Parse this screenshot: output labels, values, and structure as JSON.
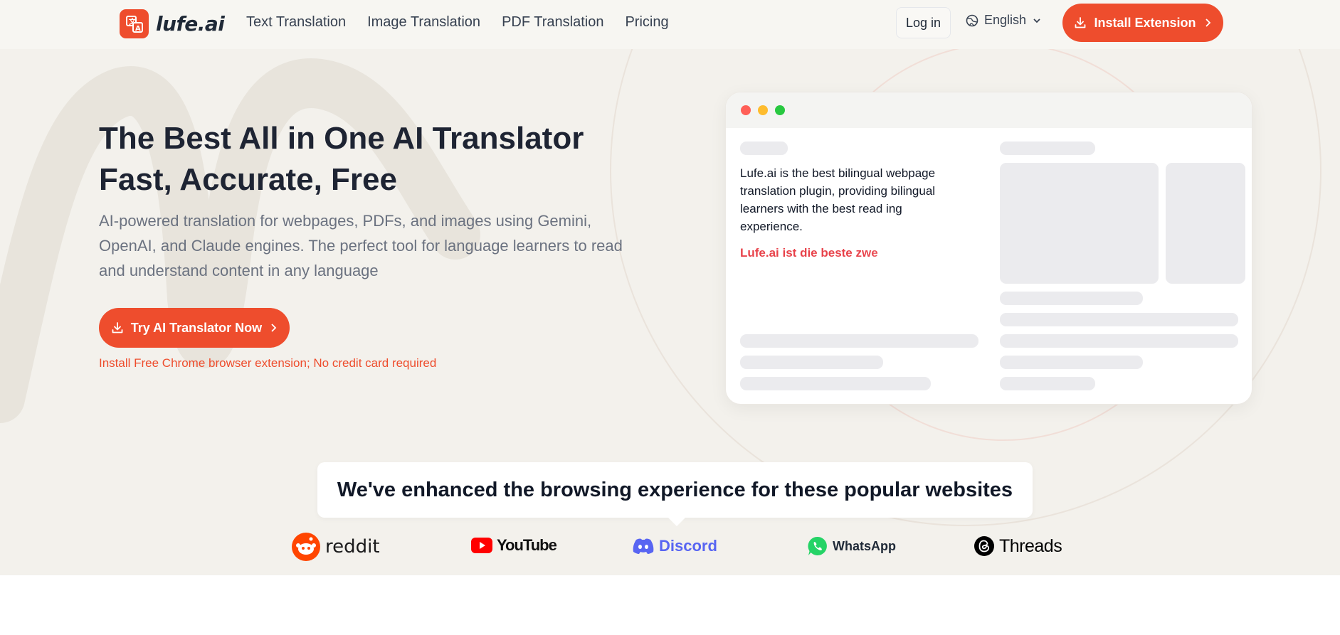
{
  "brand": {
    "name": "lufe.ai",
    "accent": "#ee4d2d"
  },
  "nav": {
    "links": [
      "Text Translation",
      "Image Translation",
      "PDF Translation",
      "Pricing"
    ],
    "login_label": "Log in",
    "language": "English",
    "install_label": "Install Extension"
  },
  "hero": {
    "title_line1": "The Best All in One AI Translator",
    "title_line2": "Fast, Accurate, Free",
    "subtitle": "AI-powered translation for webpages, PDFs, and images using Gemini, OpenAI, and Claude engines. The perfect tool for language learners to read and understand content in any language",
    "cta_label": "Try AI Translator Now",
    "cta_note": "Install Free Chrome browser extension; No credit card required"
  },
  "mockup": {
    "window_dots": [
      "#ff5f57",
      "#febc2e",
      "#28c840"
    ],
    "english_text": "Lufe.ai is the best bilingual webpage translation plugin, providing bilingual learners with the best read ing experience.",
    "german_text": "Lufe.ai ist die beste zwe"
  },
  "popular": {
    "heading": "We've enhanced the browsing experience for these popular websites",
    "sites": [
      {
        "name": "reddit",
        "icon": "reddit-icon",
        "color": "#ff4500"
      },
      {
        "name": "YouTube",
        "icon": "youtube-icon",
        "color": "#ff0000"
      },
      {
        "name": "Discord",
        "icon": "discord-icon",
        "color": "#5865f2"
      },
      {
        "name": "WhatsApp",
        "icon": "whatsapp-icon",
        "color": "#25d366"
      },
      {
        "name": "Threads",
        "icon": "threads-icon",
        "color": "#000000"
      }
    ]
  }
}
